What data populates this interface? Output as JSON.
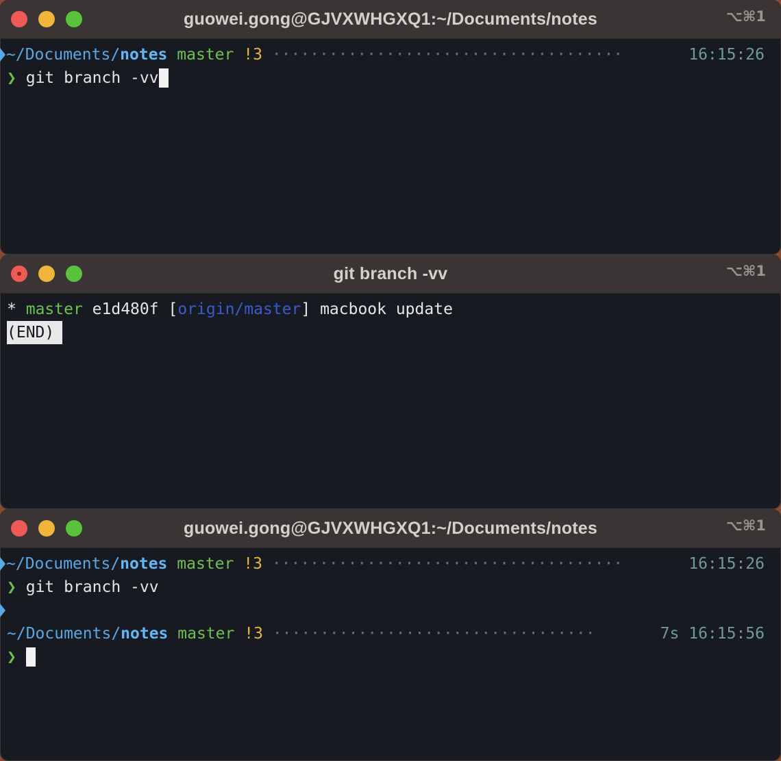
{
  "windows": [
    {
      "title": "guowei.gong@GJVXWHGXQ1:~/Documents/notes",
      "shortcut": "⌥⌘1",
      "prompt1": {
        "path_prefix": "~/Documents/",
        "dir": "notes",
        "branch": "master",
        "status": "!3",
        "dots": "·····································",
        "time": "16:15:26"
      },
      "command": {
        "symbol": "❯",
        "text": "git branch -vv"
      }
    },
    {
      "title": "git branch -vv",
      "shortcut": "⌥⌘1",
      "output": {
        "star": "*",
        "branch": "master",
        "hash": "e1d480f",
        "open_bracket": "[",
        "remote": "origin/master",
        "close_bracket": "]",
        "message": "macbook update"
      },
      "end_label": "(END)"
    },
    {
      "title": "guowei.gong@GJVXWHGXQ1:~/Documents/notes",
      "shortcut": "⌥⌘1",
      "prompt1": {
        "path_prefix": "~/Documents/",
        "dir": "notes",
        "branch": "master",
        "status": "!3",
        "dots": "·····································",
        "time": "16:15:26"
      },
      "command": {
        "symbol": "❯",
        "text": "git branch -vv"
      },
      "prompt2": {
        "path_prefix": "~/Documents/",
        "dir": "notes",
        "branch": "master",
        "status": "!3",
        "dots": "··································",
        "duration": "7s",
        "time": "16:15:56"
      },
      "prompt_symbol": "❯"
    }
  ]
}
